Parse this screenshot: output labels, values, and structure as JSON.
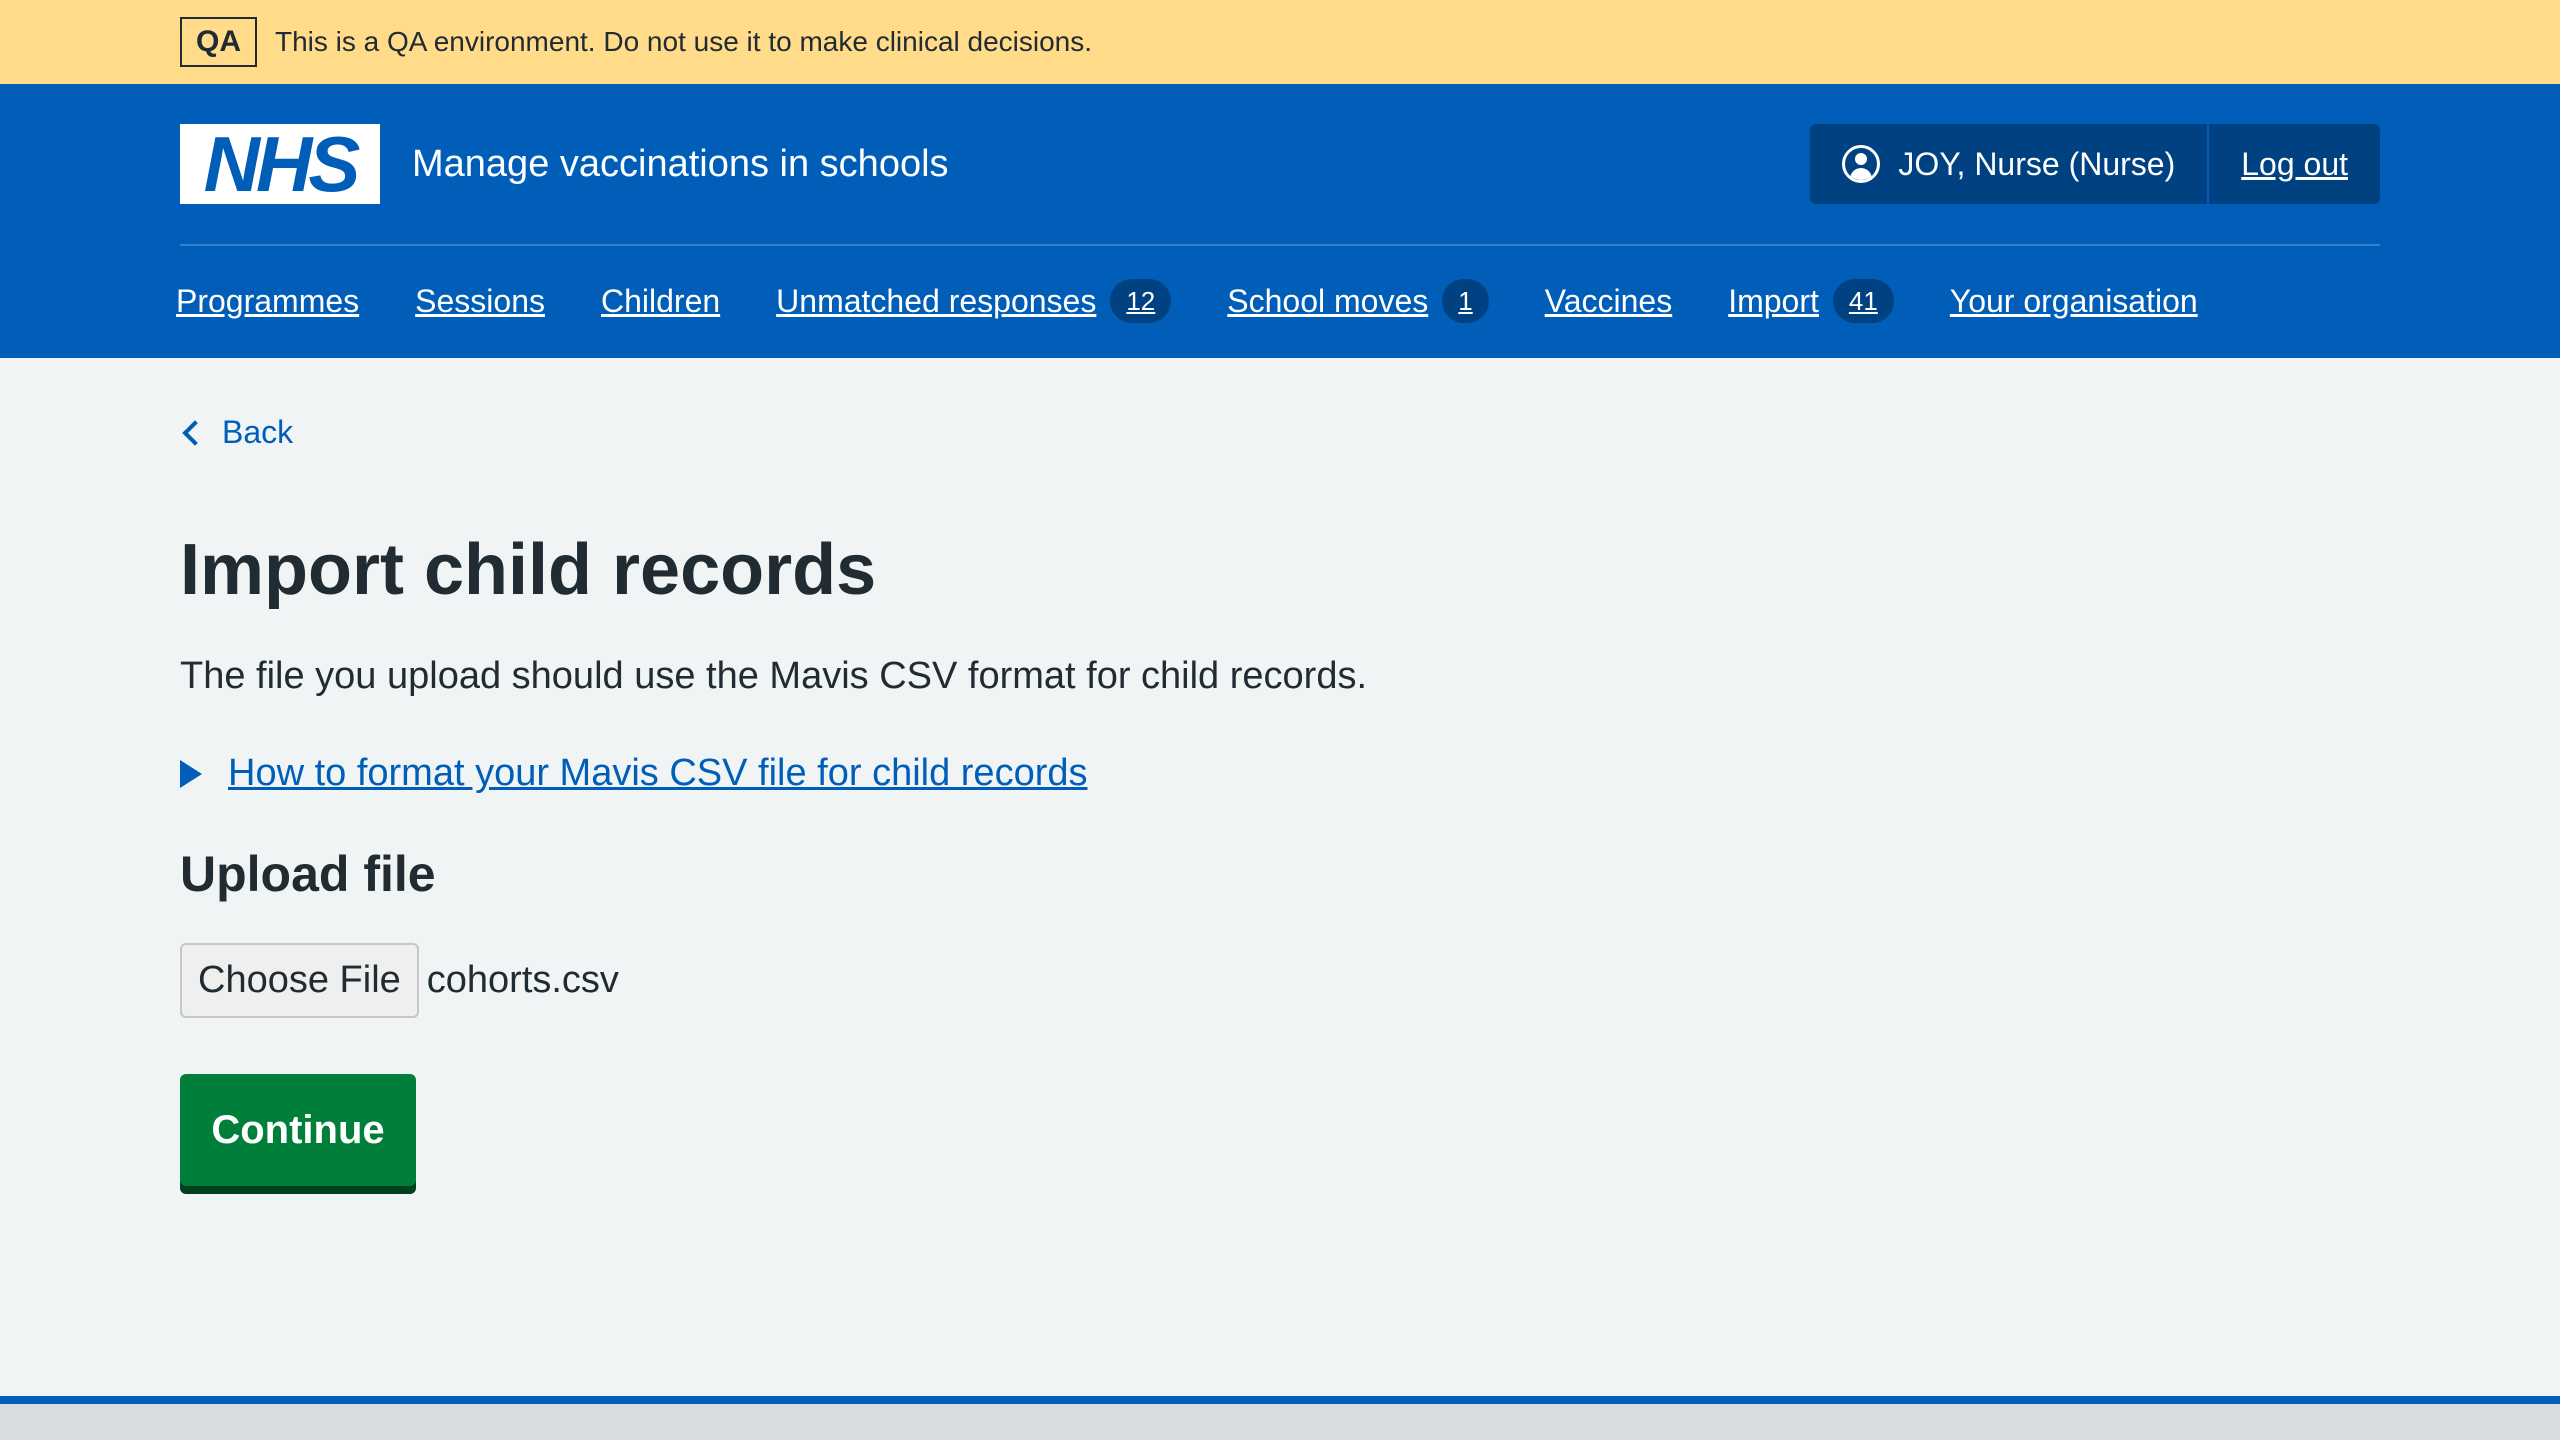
{
  "qa_banner": {
    "tag": "QA",
    "text": "This is a QA environment. Do not use it to make clinical decisions."
  },
  "header": {
    "logo_text": "NHS",
    "service_name": "Manage vaccinations in schools",
    "account": {
      "user_icon": "user-circle-icon",
      "user_label": "JOY, Nurse (Nurse)",
      "logout_label": "Log out"
    }
  },
  "nav": {
    "items": [
      {
        "label": "Programmes"
      },
      {
        "label": "Sessions"
      },
      {
        "label": "Children"
      },
      {
        "label": "Unmatched responses",
        "count": "12"
      },
      {
        "label": "School moves",
        "count": "1"
      },
      {
        "label": "Vaccines"
      },
      {
        "label": "Import",
        "count": "41"
      },
      {
        "label": "Your organisation"
      }
    ]
  },
  "main": {
    "back_label": "Back",
    "title": "Import child records",
    "intro": "The file you upload should use the Mavis CSV format for child records.",
    "details_summary": "How to format your Mavis CSV file for child records",
    "upload_heading": "Upload file",
    "file_button_label": "Choose File",
    "file_name": "cohorts.csv",
    "continue_label": "Continue"
  },
  "colors": {
    "brand_blue": "#005eb8",
    "qa_yellow": "#ffdb8a",
    "button_green": "#007f3b",
    "page_bg": "#f0f4f5"
  }
}
